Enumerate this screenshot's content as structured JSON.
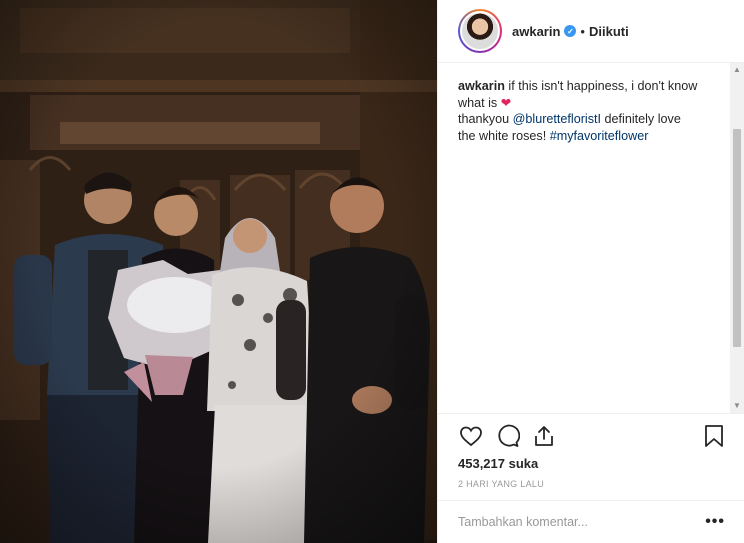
{
  "post": {
    "photo_alt": "Foto",
    "header": {
      "username": "awkarin",
      "verified": true,
      "separator": "•",
      "follow_status": "Diikuti"
    },
    "caption": {
      "username": "awkarin",
      "line1": "if this isn't happiness, i don't know",
      "line2": "what is",
      "heart": "❤",
      "thank_prefix": "thankyou",
      "mention": "@blurettefloristI",
      "thank_suffix": "definitely love",
      "line4": "the white roses!",
      "hashtag": "#myfavoriteflower"
    },
    "likes": "453,217 suka",
    "timestamp": "2 HARI YANG LALU",
    "comment": {
      "placeholder": "Tambahkan komentar...",
      "more": "•••"
    },
    "colors": {
      "link": "#003569",
      "heart": "#e0245e",
      "verified": "#3897f0"
    },
    "icons": [
      "heart-icon",
      "comment-icon",
      "share-icon",
      "bookmark-icon"
    ]
  }
}
